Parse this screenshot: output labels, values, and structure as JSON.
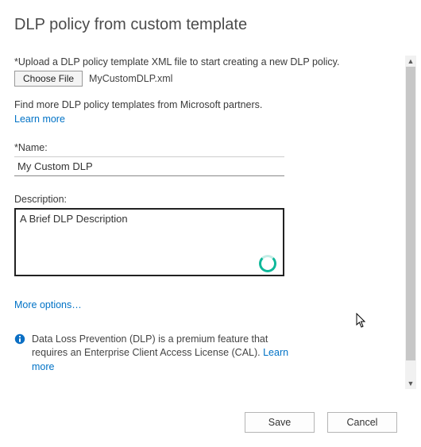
{
  "title": "DLP policy from custom template",
  "upload_instruction": "*Upload a DLP policy template XML file to start creating a new DLP policy.",
  "choose_file_label": "Choose File",
  "filename": "MyCustomDLP.xml",
  "partners_text": "Find more DLP policy templates from Microsoft partners.",
  "learn_more": "Learn more",
  "name_label": "*Name:",
  "name_value": "My Custom DLP",
  "description_label": "Description:",
  "description_value": "A Brief DLP Description",
  "more_options": "More options…",
  "info_text_1": "Data Loss Prevention (DLP) is a premium feature that requires an Enterprise Client Access License (CAL). ",
  "info_link": "Learn more",
  "footer": {
    "save": "Save",
    "cancel": "Cancel"
  }
}
